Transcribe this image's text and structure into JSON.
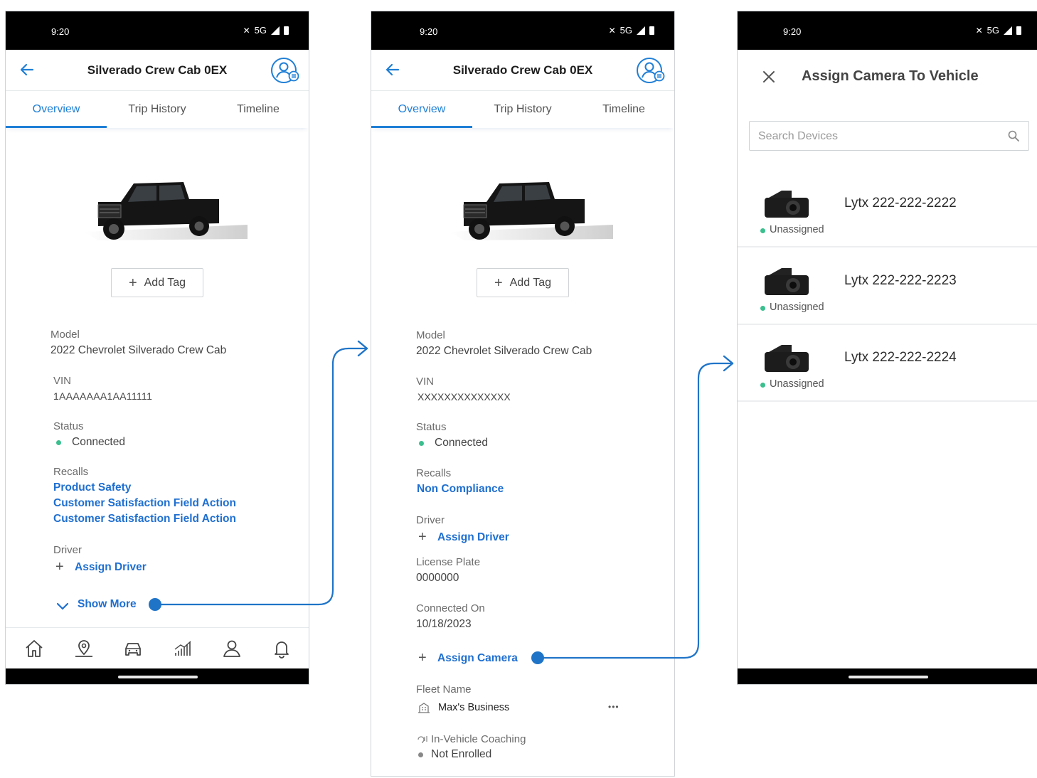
{
  "status_bar": {
    "time": "9:20",
    "network": "5G"
  },
  "vehicle_screen": {
    "title": "Silverado Crew Cab 0EX",
    "tabs": [
      "Overview",
      "Trip History",
      "Timeline"
    ],
    "add_tag_label": "Add Tag",
    "model_label": "Model",
    "model_value": "2022 Chevrolet Silverado Crew Cab",
    "vin_label": "VIN",
    "status_label": "Status",
    "status_value": "Connected",
    "recalls_label": "Recalls",
    "driver_label": "Driver",
    "assign_driver": "Assign Driver"
  },
  "screen1": {
    "vin_value": "1AAAAAAA1AA11111",
    "recalls": [
      "Product Safety",
      "Customer Satisfaction Field Action",
      "Customer Satisfaction Field Action"
    ],
    "show_more": "Show More",
    "bottom_nav": [
      "home-icon",
      "map-pin-icon",
      "car-icon",
      "chart-icon",
      "profile-icon",
      "bell-icon"
    ]
  },
  "screen2": {
    "vin_value": "XXXXXXXXXXXXXX",
    "recalls": [
      "Non Compliance"
    ],
    "license_plate_label": "License Plate",
    "license_plate_value": "0000000",
    "connected_on_label": "Connected On",
    "connected_on_value": "10/18/2023",
    "assign_camera": "Assign Camera",
    "fleet_name_label": "Fleet Name",
    "fleet_name_value": "Max's Business",
    "more_label": "•••",
    "coaching_label": "In-Vehicle Coaching",
    "coaching_value": "Not Enrolled"
  },
  "screen3": {
    "title": "Assign Camera To Vehicle",
    "search_placeholder": "Search Devices",
    "devices": [
      {
        "name": "Lytx 222-222-2222",
        "status": "Unassigned"
      },
      {
        "name": "Lytx 222-222-2223",
        "status": "Unassigned"
      },
      {
        "name": "Lytx 222-222-2224",
        "status": "Unassigned"
      }
    ]
  },
  "colors": {
    "accent": "#1f7fd6",
    "link": "#1f6fd0",
    "connected": "#3bbf8f",
    "flow_arrow": "#1f74c8"
  }
}
